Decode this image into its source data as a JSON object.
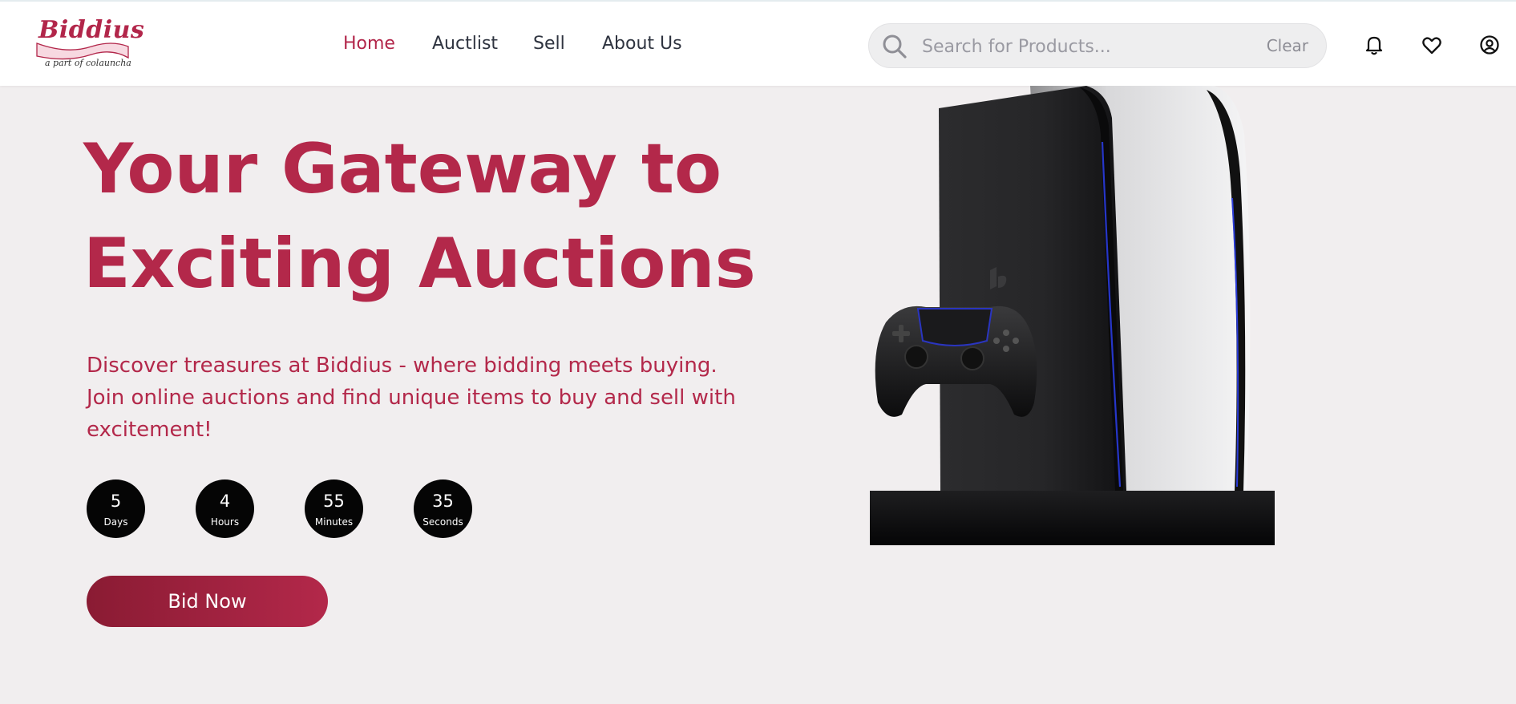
{
  "brand": {
    "name": "Biddius",
    "tagline": "a part of colauncha",
    "color": "#b2264a"
  },
  "nav": {
    "items": [
      {
        "label": "Home",
        "active": true
      },
      {
        "label": "Auctlist",
        "active": false
      },
      {
        "label": "Sell",
        "active": false
      },
      {
        "label": "About Us",
        "active": false
      }
    ]
  },
  "search": {
    "placeholder": "Search for Products...",
    "value": "",
    "clear_label": "Clear",
    "icon": "search-icon"
  },
  "header_icons": [
    "bell-icon",
    "heart-icon",
    "user-icon"
  ],
  "hero": {
    "title_line1": "Your Gateway to",
    "title_line2": "Exciting Auctions",
    "description": "Discover treasures at Biddius - where bidding meets buying. Join online auctions and find unique items to buy and sell with excitement!",
    "countdown": [
      {
        "value": "5",
        "label": "Days"
      },
      {
        "value": "4",
        "label": "Hours"
      },
      {
        "value": "55",
        "label": "Minutes"
      },
      {
        "value": "35",
        "label": "Seconds"
      }
    ],
    "cta_label": "Bid Now",
    "image": "game-console-with-controller"
  },
  "colors": {
    "accent": "#b3284a",
    "accent_dark": "#8a1b33",
    "background": "#f1eeef",
    "countdown_bg": "#050505"
  }
}
